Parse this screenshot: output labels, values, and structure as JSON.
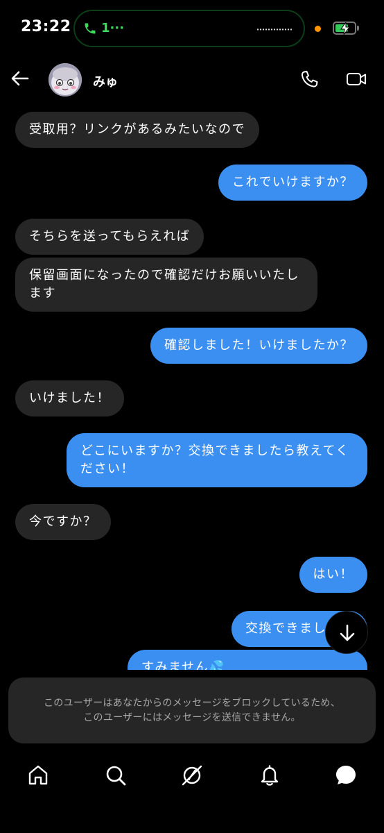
{
  "status_bar": {
    "time": "23:22",
    "call_label": "1···"
  },
  "header": {
    "contact_name": "みゅ",
    "back_icon": "arrow-left-icon",
    "call_icon": "phone-icon",
    "video_icon": "video-camera-icon"
  },
  "messages": [
    {
      "sender": "them",
      "text": "受取用？リンクがあるみたいなので"
    },
    {
      "sender": "me",
      "text": "これでいけますか？"
    },
    {
      "sender": "them",
      "text": "そちらを送ってもらえれば"
    },
    {
      "sender": "them",
      "text": "保留画面になったので確認だけお願いいたし\nます"
    },
    {
      "sender": "me",
      "text": "確認しました！いけましたか？"
    },
    {
      "sender": "them",
      "text": "いけました！"
    },
    {
      "sender": "me",
      "text": "どこにいますか？交換できましたら教えてく\nださい！"
    },
    {
      "sender": "them",
      "text": "今ですか？"
    },
    {
      "sender": "me",
      "text": "はい！"
    },
    {
      "sender": "me",
      "text": "交換できました！"
    },
    {
      "sender": "me",
      "text": "すみません💦"
    }
  ],
  "blocked_notice": {
    "line1": "このユーザーはあなたからのメッセージをブロックしているため、",
    "line2": "このユーザーにはメッセージを送信できません。"
  },
  "tab_bar": {
    "items": [
      "home-icon",
      "search-icon",
      "explore-icon",
      "notifications-icon",
      "messages-icon"
    ]
  },
  "colors": {
    "outgoing_bubble": "#3b8ff0",
    "incoming_bubble": "#262626",
    "background": "#000000"
  }
}
